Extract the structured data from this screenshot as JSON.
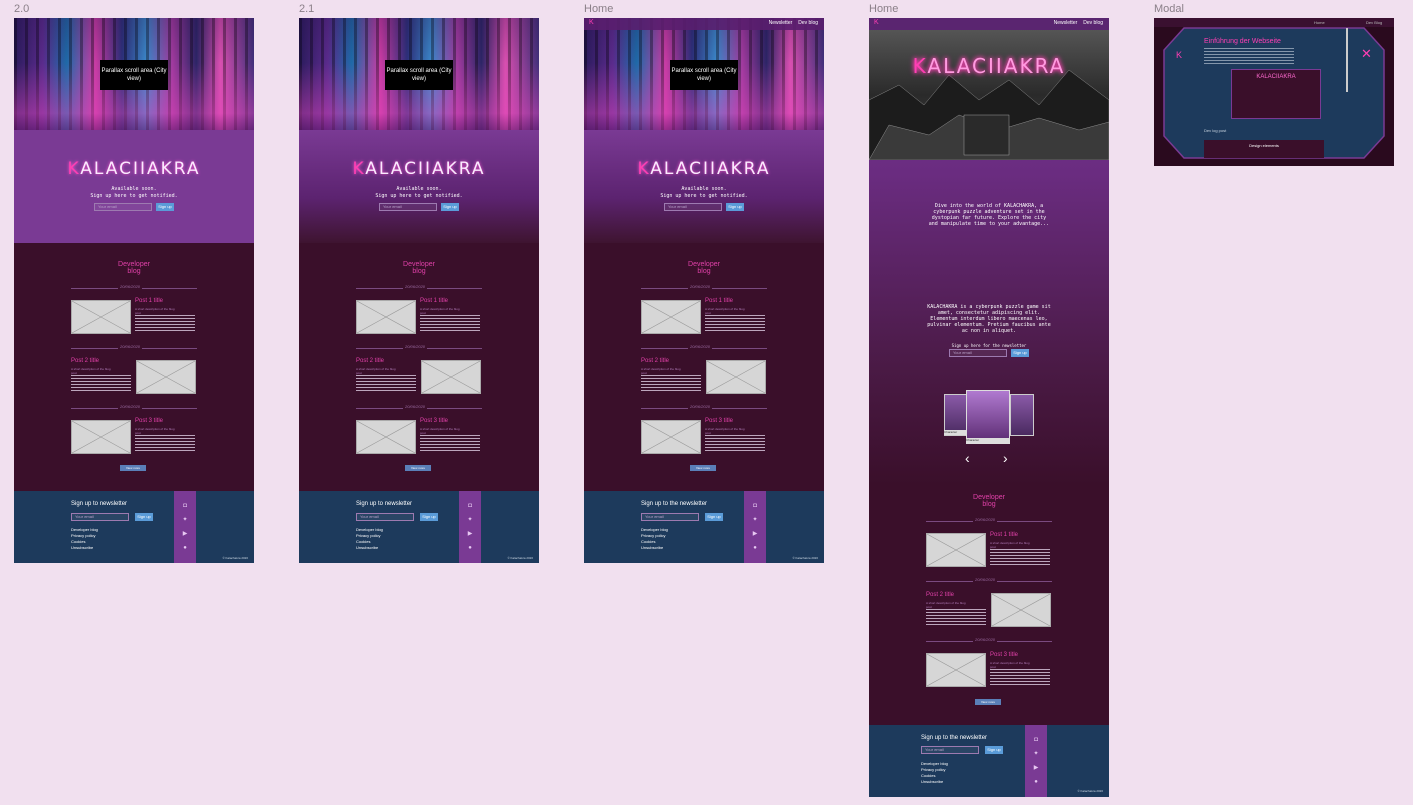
{
  "frames": [
    {
      "label": "2.0"
    },
    {
      "label": "2.1"
    },
    {
      "label": "Home"
    },
    {
      "label": "Home"
    },
    {
      "label": "Modal"
    }
  ],
  "hero": {
    "parallax": "Parallax scroll area (City view)",
    "logo_mark": "K",
    "logo_text": "ALACIIAKRA",
    "available": "Available soon.",
    "signup_line": "Sign up here to get notified.",
    "email_placeholder": "Your email",
    "signup_button": "Sign up"
  },
  "nav": {
    "newsletter": "Newsletter",
    "devblog": "Dev blog"
  },
  "blog": {
    "title_line1": "Developer",
    "title_line2": "blog",
    "date": "20/06/2020",
    "posts": [
      {
        "title": "Post 1 title",
        "sub": "A short description of the blog post"
      },
      {
        "title": "Post 2 title",
        "sub": "A short description of the blog post"
      },
      {
        "title": "Post 3 title",
        "sub": "A short description of the blog post"
      }
    ],
    "view_all": "View more"
  },
  "footer": {
    "heading": "Sign up to newsletter",
    "heading_home": "Sign up to the newsletter",
    "email_placeholder": "Your email",
    "button": "Sign up",
    "links": [
      "Developer blog",
      "Privacy policy",
      "Cookies",
      "Unsubscribe"
    ],
    "copyright_1": "© Kalachakra 2020",
    "copyright_2": "All rights reserved"
  },
  "home_long": {
    "intro": "Dive into the world of KALACHAKRA, a cyberpunk puzzle adventure set in the dystopian far future. Explore the city and manipulate time to your advantage...",
    "about": "KALACHAKRA is a cyberpunk puzzle game sit amet, consectetur adipiscing elit. Elementum interdum libero maecenas leo, pulvinar elementum. Pretium faucibus ante ac non in aliquet.",
    "newsletter_line": "Sign up here for the newsletter",
    "char_label_left": "Character",
    "char_label_mid": "Character"
  },
  "modal": {
    "nav_home": "Home",
    "nav_blog": "Dev Blog",
    "title": "Einführung der Webseite",
    "section": "Design elements",
    "sub": "Dev log post"
  },
  "colors": {
    "bg": "#f1e0ef",
    "purple": "#7a3a94",
    "dark": "#3a0f2a",
    "pink": "#e040a8",
    "footer": "#1d3a5c",
    "button": "#5a9bd8"
  }
}
